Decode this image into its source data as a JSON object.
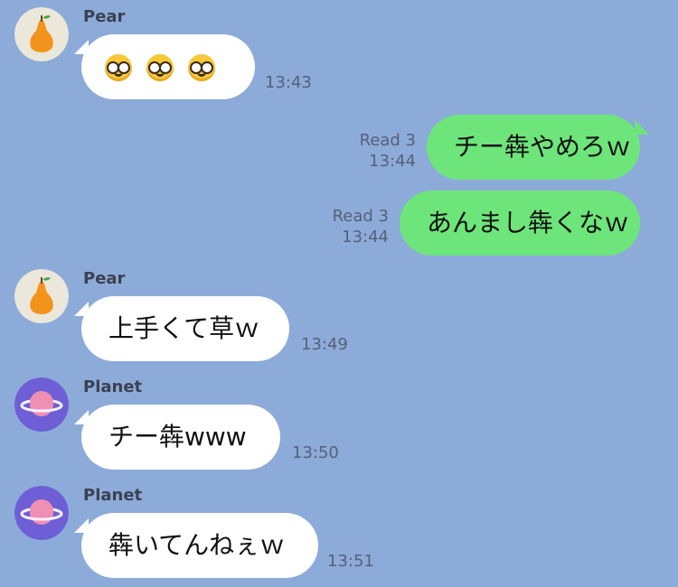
{
  "colors": {
    "background": "#8dabd8",
    "incoming_bubble": "#ffffff",
    "outgoing_bubble": "#6ee57a",
    "meta_text": "#56607a"
  },
  "messages": [
    {
      "sender": "Pear",
      "avatar": "pear-icon",
      "content": "nerd-face-emoji x3",
      "time": "13:43"
    },
    {
      "outgoing": true,
      "text": "チー犇やめろｗ",
      "read": "Read 3",
      "time": "13:44"
    },
    {
      "outgoing": true,
      "text": "あんまし犇くなｗ",
      "read": "Read 3",
      "time": "13:44"
    },
    {
      "sender": "Pear",
      "avatar": "pear-icon",
      "text": "上手くて草ｗ",
      "time": "13:49"
    },
    {
      "sender": "Planet",
      "avatar": "planet-icon",
      "text": "チー犇www",
      "time": "13:50"
    },
    {
      "sender": "Planet",
      "avatar": "planet-icon",
      "text": "犇いてんねぇｗ",
      "time": "13:51"
    }
  ]
}
